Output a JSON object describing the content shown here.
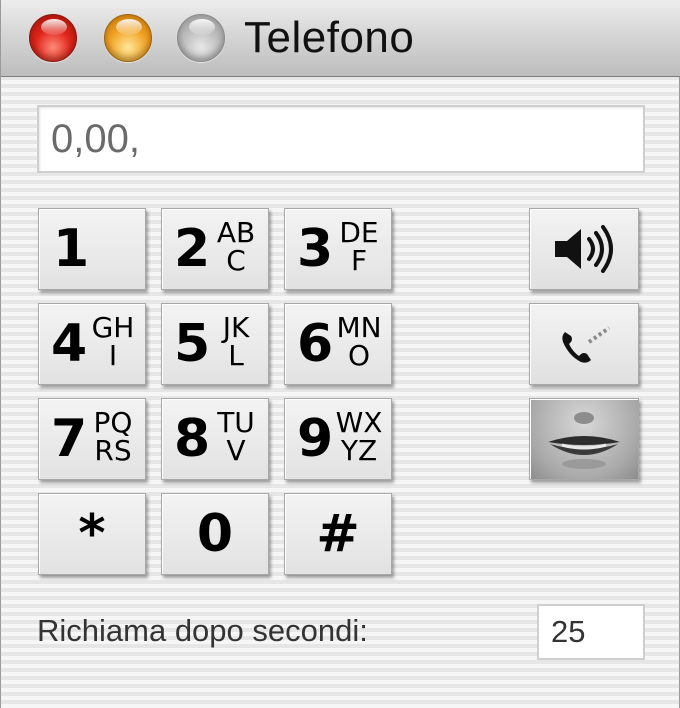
{
  "window": {
    "title": "Telefono",
    "controls": [
      "close",
      "minimize",
      "zoom"
    ]
  },
  "display": {
    "value": "0,00,"
  },
  "keypad": {
    "keys": [
      {
        "digit": "1",
        "letters": []
      },
      {
        "digit": "2",
        "letters": [
          "AB",
          "C"
        ]
      },
      {
        "digit": "3",
        "letters": [
          "DE",
          "F"
        ]
      },
      {
        "digit": "4",
        "letters": [
          "GH",
          "I"
        ]
      },
      {
        "digit": "5",
        "letters": [
          "JK",
          "L"
        ]
      },
      {
        "digit": "6",
        "letters": [
          "MN",
          "O"
        ]
      },
      {
        "digit": "7",
        "letters": [
          "PQ",
          "RS"
        ]
      },
      {
        "digit": "8",
        "letters": [
          "TU",
          "V"
        ]
      },
      {
        "digit": "9",
        "letters": [
          "WX",
          "YZ"
        ]
      },
      {
        "digit": "*",
        "letters": []
      },
      {
        "digit": "0",
        "letters": []
      },
      {
        "digit": "#",
        "letters": []
      }
    ]
  },
  "side_buttons": [
    {
      "icon": "speaker-icon"
    },
    {
      "icon": "phone-handset-icon"
    },
    {
      "icon": "mouth-icon"
    }
  ],
  "recall": {
    "label": "Richiama dopo secondi:",
    "seconds": "25"
  }
}
